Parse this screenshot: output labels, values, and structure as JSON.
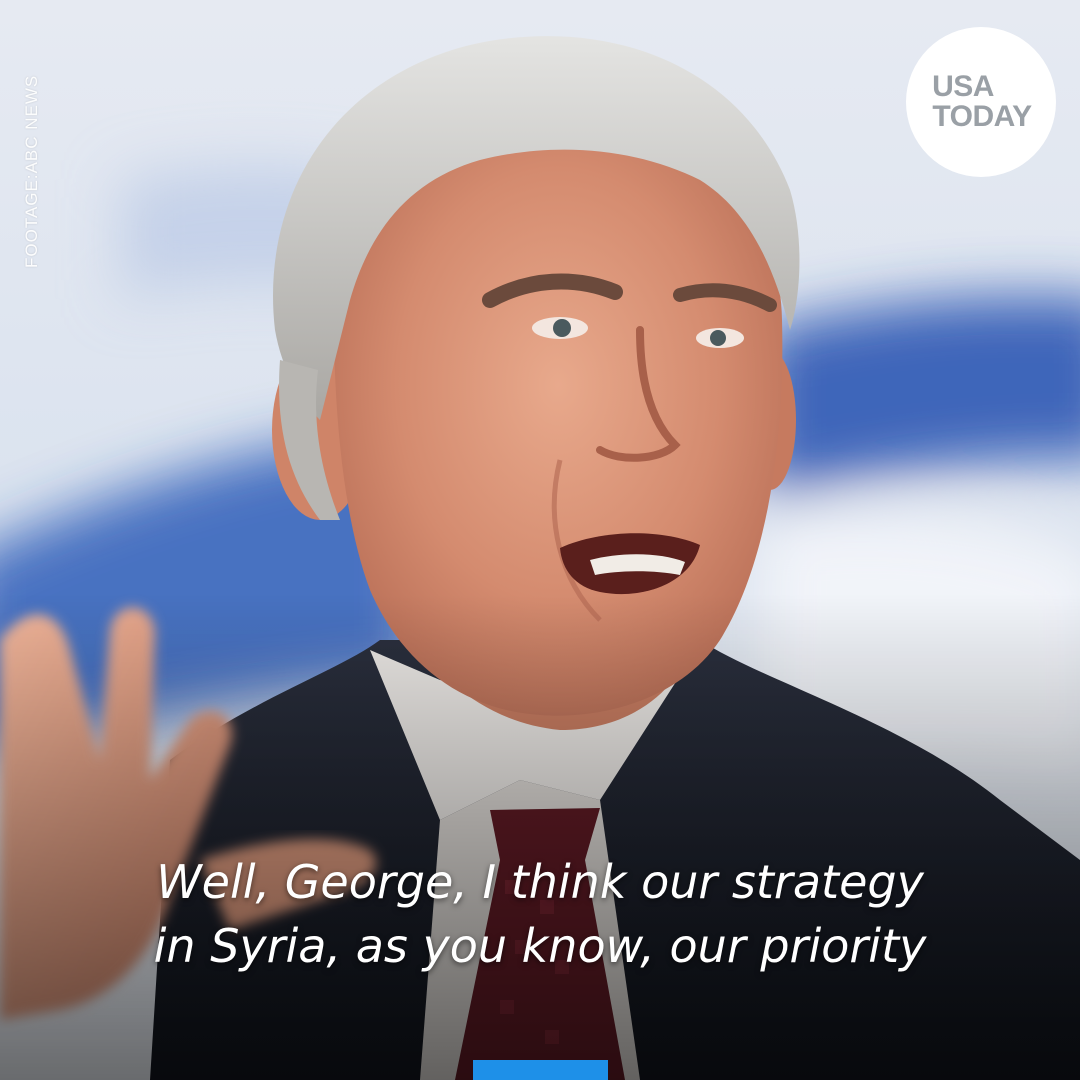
{
  "credit": {
    "text": "FOOTAGE:ABC NEWS"
  },
  "logo": {
    "line1": "USA",
    "line2": "TODAY"
  },
  "caption": {
    "line1": "Well, George, I think our strategy",
    "line2": "in Syria, as you know, our priority"
  },
  "colors": {
    "accent_bar": "#1e90e8",
    "logo_background": "#ffffff",
    "logo_text": "#9aa0a6",
    "caption_text": "#ffffff"
  }
}
